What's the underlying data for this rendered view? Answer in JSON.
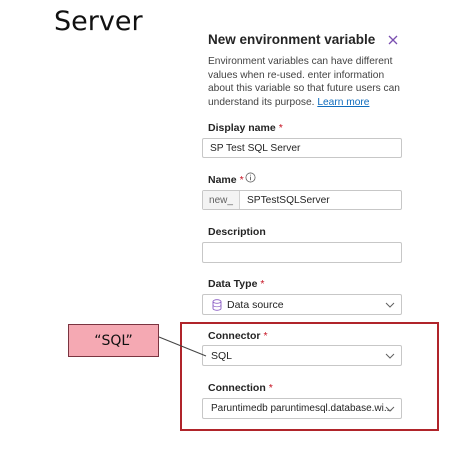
{
  "slide_title": "Server",
  "callout_text": "“SQL”",
  "panel": {
    "title": "New environment variable",
    "description": "Environment variables can have different values when re-used. enter information about this variable so that future users can understand its purpose.",
    "learn_more": "Learn more",
    "display_name": {
      "label": "Display name",
      "required": "*",
      "value": "SP Test SQL Server"
    },
    "name": {
      "label": "Name",
      "required": "*",
      "prefix": "new_",
      "value": "SPTestSQLServer"
    },
    "description_field": {
      "label": "Description",
      "value": ""
    },
    "data_type": {
      "label": "Data Type",
      "required": "*",
      "value": "Data source"
    },
    "connector": {
      "label": "Connector",
      "required": "*",
      "value": "SQL"
    },
    "connection": {
      "label": "Connection",
      "required": "*",
      "value": "Paruntimedb paruntimesql.database.wi..."
    }
  },
  "icons": {
    "close": "close-icon",
    "info": "info-icon",
    "database": "database-icon",
    "chevron": "chevron-down-icon"
  },
  "colors": {
    "accent": "#0f6cbd",
    "required": "#c50f1f",
    "highlight_border": "#b0242a",
    "callout_fill": "#f5a9b3"
  }
}
